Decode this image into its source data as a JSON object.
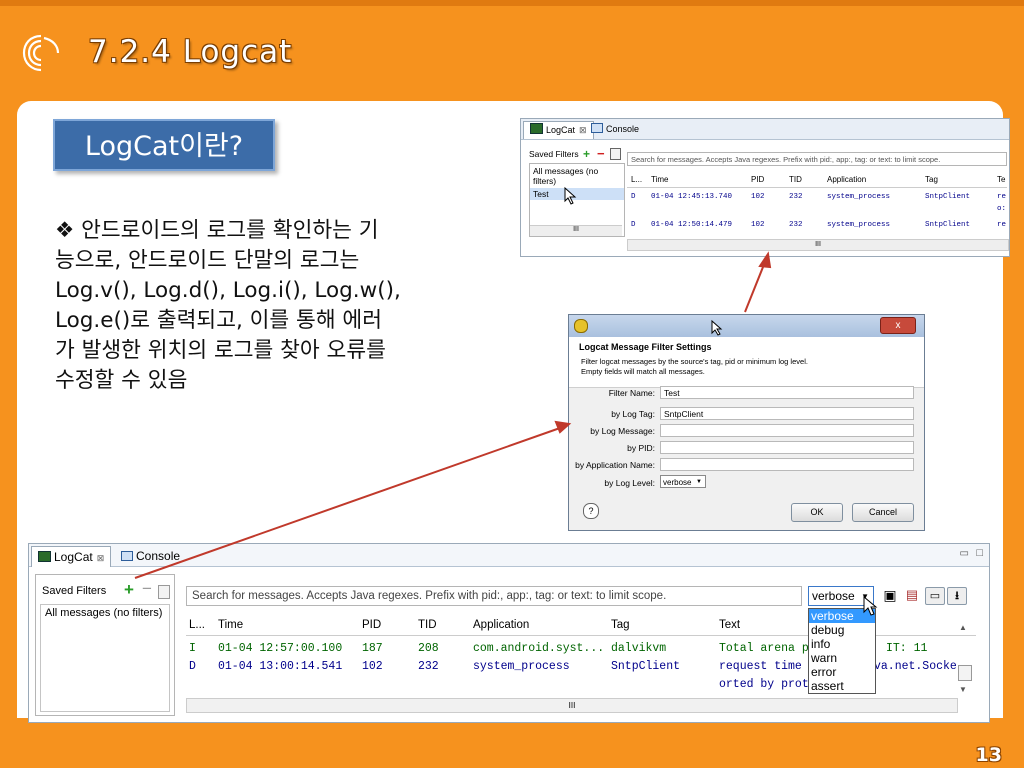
{
  "slide": {
    "title": "7.2.4 Logcat",
    "heading": "LogCat이란?",
    "body_lines": [
      "❖ 안드로이드의 로그를 확인하는 기",
      "능으로, 안드로이드 단말의 로그는",
      "Log.v(), Log.d(), Log.i(), Log.w(),",
      "Log.e()로 출력되고, 이를 통해 에러",
      "가 발생한 위치의 로그를 찾아 오류를",
      "수정할 수 있음"
    ],
    "page_number": "13",
    "colors": {
      "background": "#f6921e",
      "heading_box": "#3c6ca8"
    }
  },
  "logcat_top": {
    "tab_logcat": "LogCat",
    "tab_console": "Console",
    "saved_filters": "Saved Filters",
    "filters": [
      "All messages (no filters)",
      "Test"
    ],
    "search_placeholder": "Search for messages. Accepts Java regexes. Prefix with pid:, app:, tag: or text: to limit scope.",
    "columns": [
      "L...",
      "Time",
      "PID",
      "TID",
      "Application",
      "Tag",
      "Te"
    ],
    "rows": [
      {
        "level": "D",
        "time": "01-04 12:45:13.740",
        "pid": "102",
        "tid": "232",
        "app": "system_process",
        "tag": "SntpClient",
        "text": "re"
      },
      {
        "level": "",
        "time": "",
        "pid": "",
        "tid": "",
        "app": "",
        "tag": "",
        "text": "o:"
      },
      {
        "level": "D",
        "time": "01-04 12:50:14.479",
        "pid": "102",
        "tid": "232",
        "app": "system_process",
        "tag": "SntpClient",
        "text": "re"
      }
    ],
    "scroll_glyph": "III"
  },
  "filter_dialog": {
    "title": "Logcat Message Filter Settings",
    "description_1": "Filter logcat messages by the source's tag, pid or minimum log level.",
    "description_2": "Empty fields will match all messages.",
    "filter_name_label": "Filter Name:",
    "filter_name_value": "Test",
    "log_tag_label": "by Log Tag:",
    "log_tag_value": "SntpClient",
    "log_message_label": "by Log Message:",
    "log_message_value": "",
    "pid_label": "by PID:",
    "pid_value": "",
    "app_name_label": "by Application Name:",
    "app_name_value": "",
    "log_level_label": "by Log Level:",
    "log_level_value": "verbose",
    "ok_label": "OK",
    "cancel_label": "Cancel",
    "close_glyph": "x",
    "help_glyph": "?"
  },
  "logcat_bottom": {
    "tab_logcat": "LogCat",
    "tab_console": "Console",
    "saved_filters": "Saved Filters",
    "filters": [
      "All messages (no filters)"
    ],
    "search_placeholder": "Search for messages. Accepts Java regexes. Prefix with pid:, app:, tag: or text: to limit scope.",
    "level_select": "verbose",
    "level_options": [
      "verbose",
      "debug",
      "info",
      "warn",
      "error",
      "assert"
    ],
    "columns": [
      "L...",
      "Time",
      "PID",
      "TID",
      "Application",
      "Tag",
      "Text"
    ],
    "rows": [
      {
        "level": "I",
        "time": "01-04 12:57:00.100",
        "pid": "187",
        "tid": "208",
        "app": "com.android.syst...",
        "tag": "dalvikvm",
        "text": "Total arena p",
        "text_tail": "IT: 11"
      },
      {
        "level": "D",
        "time": "01-04 13:00:14.541",
        "pid": "102",
        "tid": "232",
        "app": "system_process",
        "tag": "SntpClient",
        "text": "request time",
        "text_tail": "va.net.Socke"
      },
      {
        "level": "",
        "time": "",
        "pid": "",
        "tid": "",
        "app": "",
        "tag": "",
        "text": "orted by prot",
        "text_tail": ""
      }
    ],
    "scroll_glyph": "III"
  }
}
